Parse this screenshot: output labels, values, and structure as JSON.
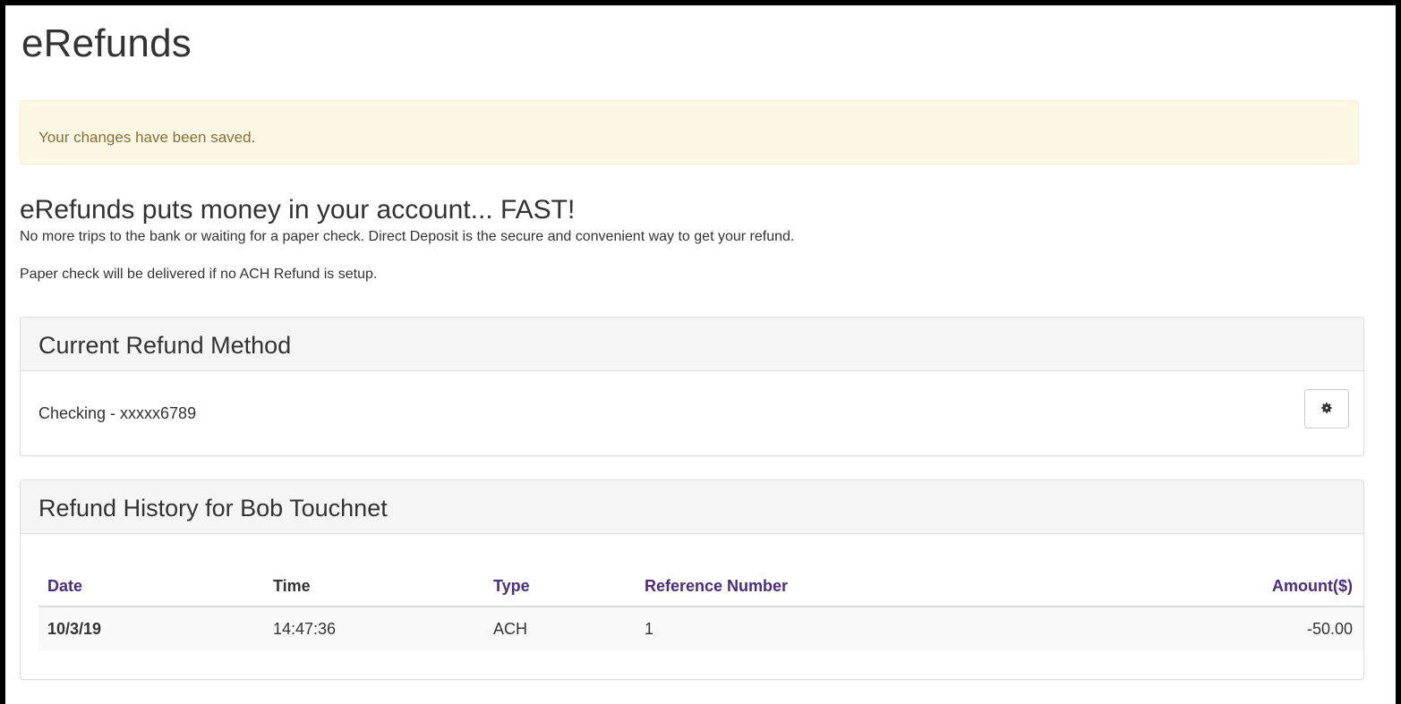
{
  "page": {
    "title": "eRefunds"
  },
  "alert": {
    "message": "Your changes have been saved."
  },
  "intro": {
    "headline": "eRefunds puts money in your account... FAST!",
    "line1": "No more trips to the bank or waiting for a paper check. Direct Deposit is the secure and convenient way to get your refund.",
    "line2": "Paper check will be delivered if no ACH Refund is setup."
  },
  "current_method": {
    "heading": "Current Refund Method",
    "value": "Checking - xxxxx6789",
    "settings_icon": "gear-icon"
  },
  "history": {
    "heading": "Refund History for Bob Touchnet",
    "columns": {
      "date": "Date",
      "time": "Time",
      "type": "Type",
      "reference": "Reference Number",
      "amount": "Amount($)"
    },
    "rows": [
      {
        "date": "10/3/19",
        "time": "14:47:36",
        "type": "ACH",
        "reference": "1",
        "amount": "-50.00"
      }
    ]
  },
  "colors": {
    "link_purple": "#4b2c7f",
    "alert_bg": "#fcf8e3",
    "alert_text": "#8a6d3b",
    "panel_heading_bg": "#f5f5f5"
  }
}
